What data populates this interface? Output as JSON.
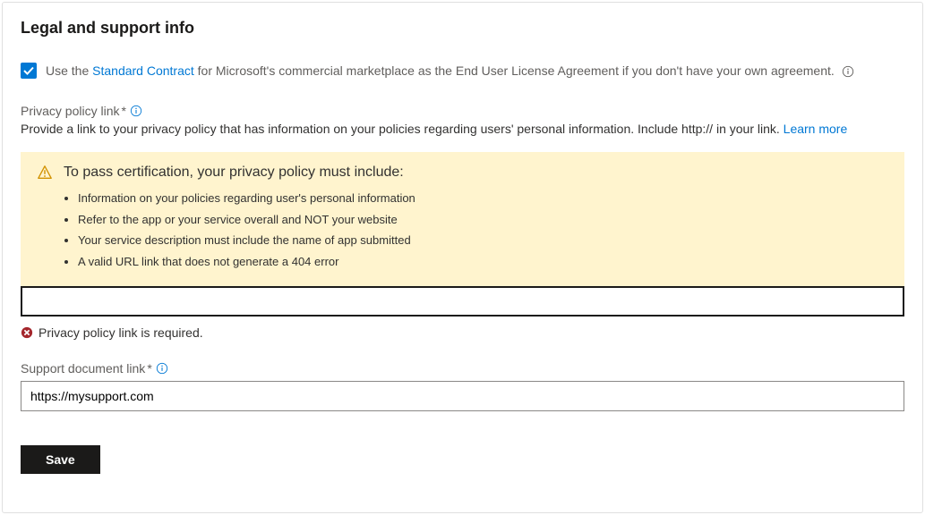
{
  "section_title": "Legal and support info",
  "standard_contract": {
    "checked": true,
    "prefix": "Use the ",
    "link_text": "Standard Contract",
    "suffix": " for Microsoft's commercial marketplace as the End User License Agreement if you don't have your own agreement."
  },
  "privacy_policy": {
    "label": "Privacy policy link",
    "required": "*",
    "description_prefix": "Provide a link to your privacy policy that has information on your policies regarding users' personal information. Include http:// in your link. ",
    "learn_more": "Learn more",
    "value": "",
    "error": "Privacy policy link is required."
  },
  "warning": {
    "title": "To pass certification, your privacy policy must include:",
    "items": [
      "Information on your policies regarding user's personal information",
      "Refer to the app or your service overall and NOT your website",
      "Your service description must include the name of app submitted",
      "A valid URL link that does not generate a 404 error"
    ]
  },
  "support_document": {
    "label": "Support document link",
    "required": "*",
    "value": "https://mysupport.com"
  },
  "save_button": "Save"
}
